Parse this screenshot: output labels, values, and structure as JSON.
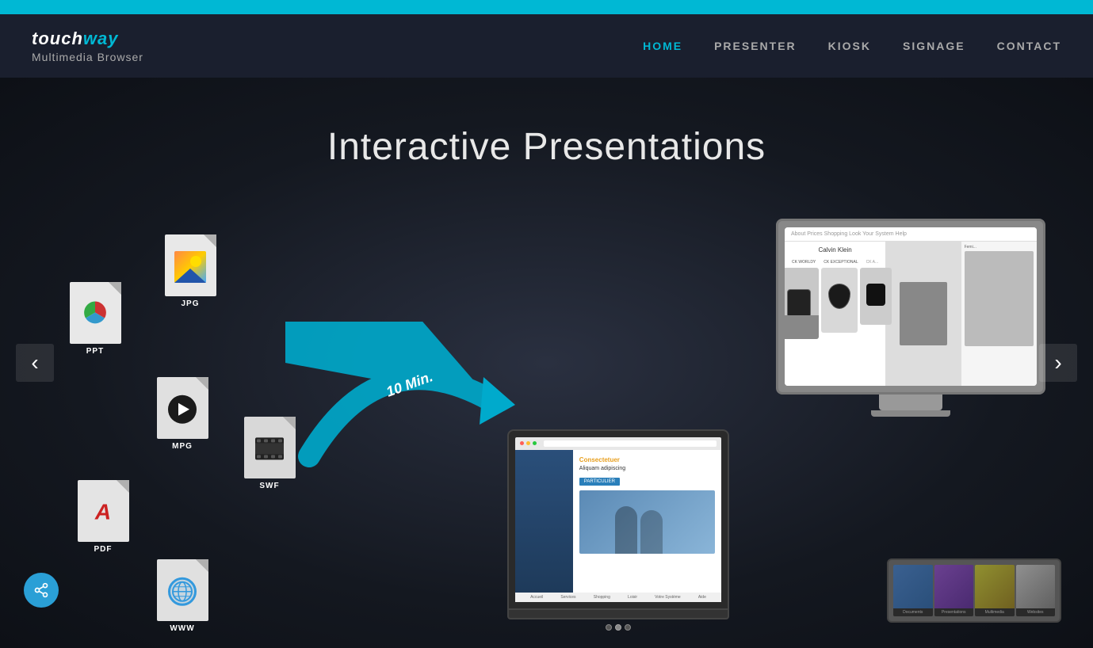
{
  "top_bar": {
    "color": "#00b8d4"
  },
  "header": {
    "logo_touch": "touch",
    "logo_way": "way",
    "logo_subtitle": "Multimedia Browser",
    "nav": {
      "items": [
        {
          "label": "HOME",
          "active": true
        },
        {
          "label": "PRESENTER",
          "active": false
        },
        {
          "label": "KIOSK",
          "active": false
        },
        {
          "label": "SIGNAGE",
          "active": false
        },
        {
          "label": "CONTACT",
          "active": false
        }
      ]
    }
  },
  "hero": {
    "title": "Interactive Presentations",
    "arrow_label": "10 Min.",
    "arrow_left": "‹",
    "arrow_right": "›"
  },
  "file_icons": [
    {
      "type": "PPT",
      "label": "PPT"
    },
    {
      "type": "JPG",
      "label": "JPG"
    },
    {
      "type": "MPG",
      "label": "MPG"
    },
    {
      "type": "SWF",
      "label": "SWF"
    },
    {
      "type": "PDF",
      "label": "PDF"
    },
    {
      "type": "WWW",
      "label": "WWW"
    }
  ],
  "monitor": {
    "brand": "Calvin Klein",
    "col_labels": [
      "CK WORLDY",
      "CK EXCEPTIONAL",
      "CK A..."
    ]
  },
  "tablet_grid": {
    "labels": [
      "Documents",
      "Presentations",
      "Multimedia",
      "Websites"
    ]
  },
  "share_button": {
    "icon": "share"
  }
}
